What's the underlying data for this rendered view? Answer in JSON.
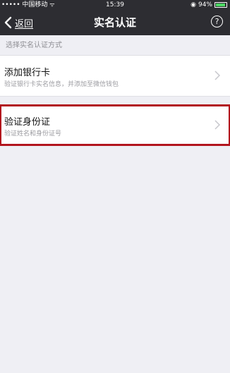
{
  "status_bar": {
    "carrier": "••••• 中国移动",
    "time": "15:39",
    "battery": "94%",
    "battery_level": 0.94
  },
  "nav": {
    "back_label": "返回",
    "title": "实名认证",
    "help_glyph": "?"
  },
  "section": {
    "header": "选择实名认证方式"
  },
  "options": [
    {
      "title": "添加银行卡",
      "subtitle": "验证银行卡实名信息，并添加至微信钱包"
    },
    {
      "title": "验证身份证",
      "subtitle": "验证姓名和身份证号"
    }
  ],
  "colors": {
    "nav_background": "#2d2d32",
    "page_background": "#efeff4",
    "highlight_border": "#b2151d",
    "battery_green": "#4cd964"
  },
  "icons": [
    "wifi-icon",
    "alarm-icon",
    "battery-icon",
    "back-chevron-icon",
    "help-icon",
    "chevron-right-icon"
  ]
}
